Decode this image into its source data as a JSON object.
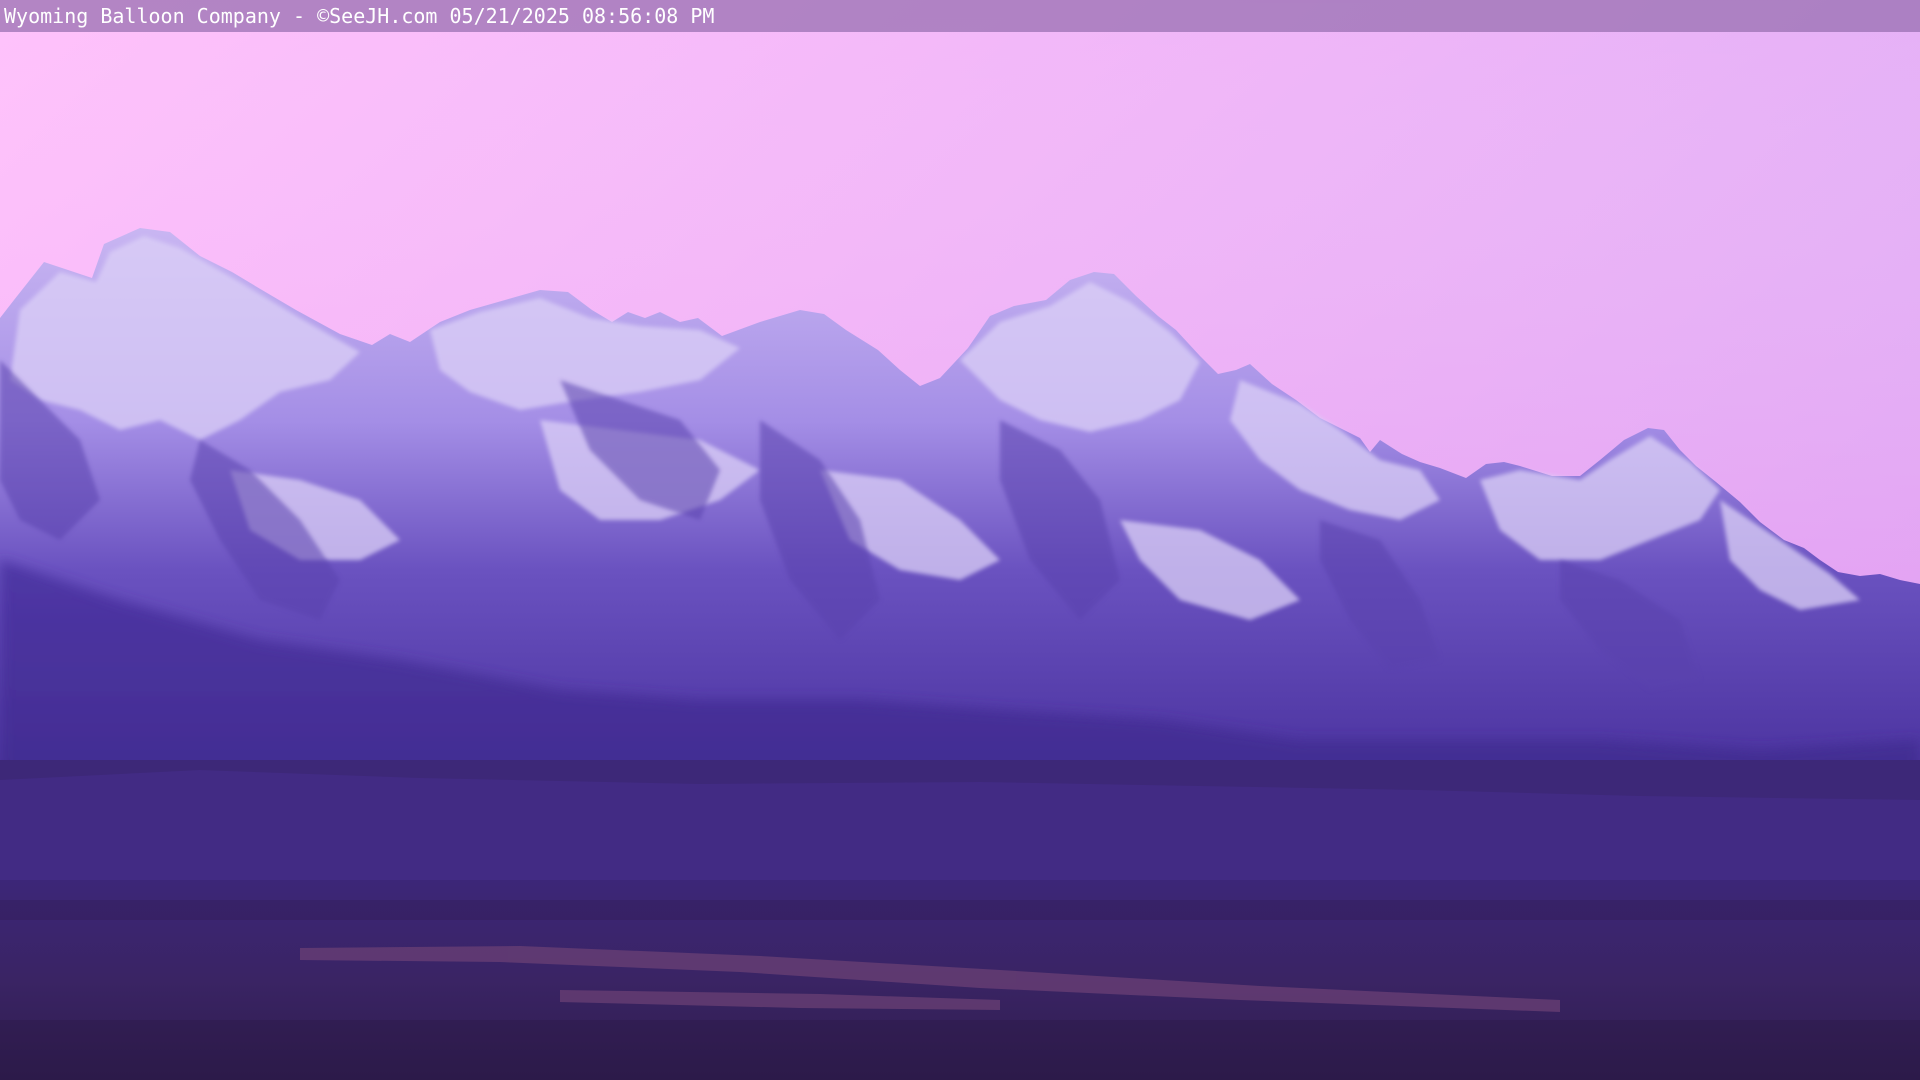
{
  "overlay": {
    "caption": "Wyoming Balloon Company - ©SeeJH.com 05/21/2025 08:56:08 PM"
  },
  "colors": {
    "sky_top_left": "#ffb8f8",
    "sky_top_right": "#dba6f5",
    "sky_horizon": "#f2a4f2",
    "snow": "#b9a9ef",
    "rock_shadow": "#5b42b0",
    "foothill": "#3f2a8e",
    "valley": "#3a2466",
    "overlay_bar": "#9a70b0"
  }
}
